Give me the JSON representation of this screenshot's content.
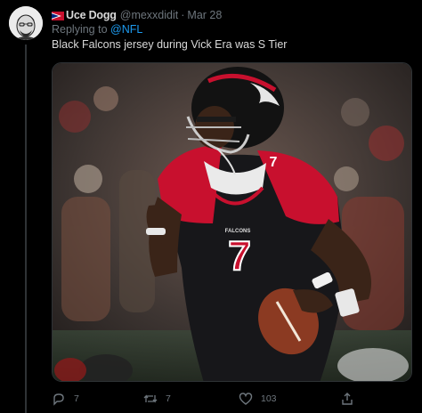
{
  "tweet": {
    "display_name": "Uce Dogg",
    "handle": "@mexxdidit",
    "separator": "·",
    "date": "Mar 28",
    "replying_to_label": "Replying to",
    "replying_to_handle": "@NFL",
    "text": "Black Falcons jersey during Vick Era was S Tier",
    "flag_icon": "american-samoa-flag-icon",
    "media_description_icon": "photo"
  },
  "jersey": {
    "number": "7",
    "team_word": "FALCONS",
    "colors": {
      "jersey": "#17171a",
      "sleeve": "#c8102e",
      "helmet": "#121212",
      "football": "#8b3a22"
    }
  },
  "actions": {
    "replies": "7",
    "retweets": "7",
    "likes": "103",
    "share_label": ""
  },
  "colors": {
    "accent": "#1d9bf0",
    "muted": "#6e767d",
    "text": "#d9d9d9",
    "background": "#000000"
  }
}
